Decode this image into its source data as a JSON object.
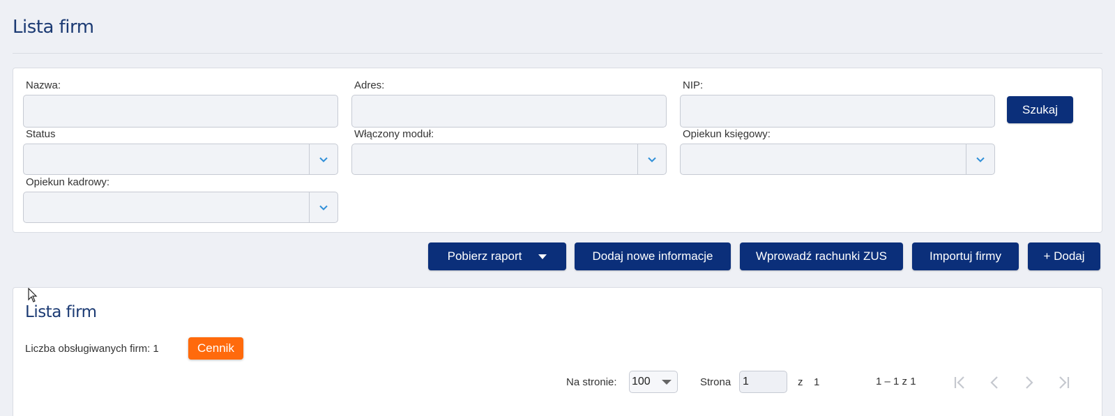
{
  "page": {
    "title": "Lista firm"
  },
  "filters": {
    "name_label": "Nazwa:",
    "address_label": "Adres:",
    "nip_label": "NIP:",
    "status_label": "Status",
    "module_label": "Włączony moduł:",
    "accountant_label": "Opiekun księgowy:",
    "hr_label": "Opiekun kadrowy:",
    "name_value": "",
    "address_value": "",
    "nip_value": "",
    "search_button": "Szukaj"
  },
  "actions": {
    "report": "Pobierz raport",
    "add_info": "Dodaj nowe informacje",
    "zus": "Wprowadź rachunki ZUS",
    "import": "Importuj firmy",
    "add": "+ Dodaj"
  },
  "list": {
    "title": "Lista firm",
    "count_text": "Liczba obsługiwanych firm: 1",
    "pricing_badge": "Cennik"
  },
  "pagination": {
    "per_page_label": "Na stronie:",
    "per_page_value": "100",
    "page_label": "Strona",
    "page_value": "1",
    "of_label": "z",
    "total_pages": "1",
    "range_text": "1 – 1 z 1"
  },
  "colors": {
    "primary": "#0b2f7a",
    "title": "#1b3a73",
    "accent_orange": "#ff6a0c",
    "chevron_blue": "#2f8fd8"
  }
}
